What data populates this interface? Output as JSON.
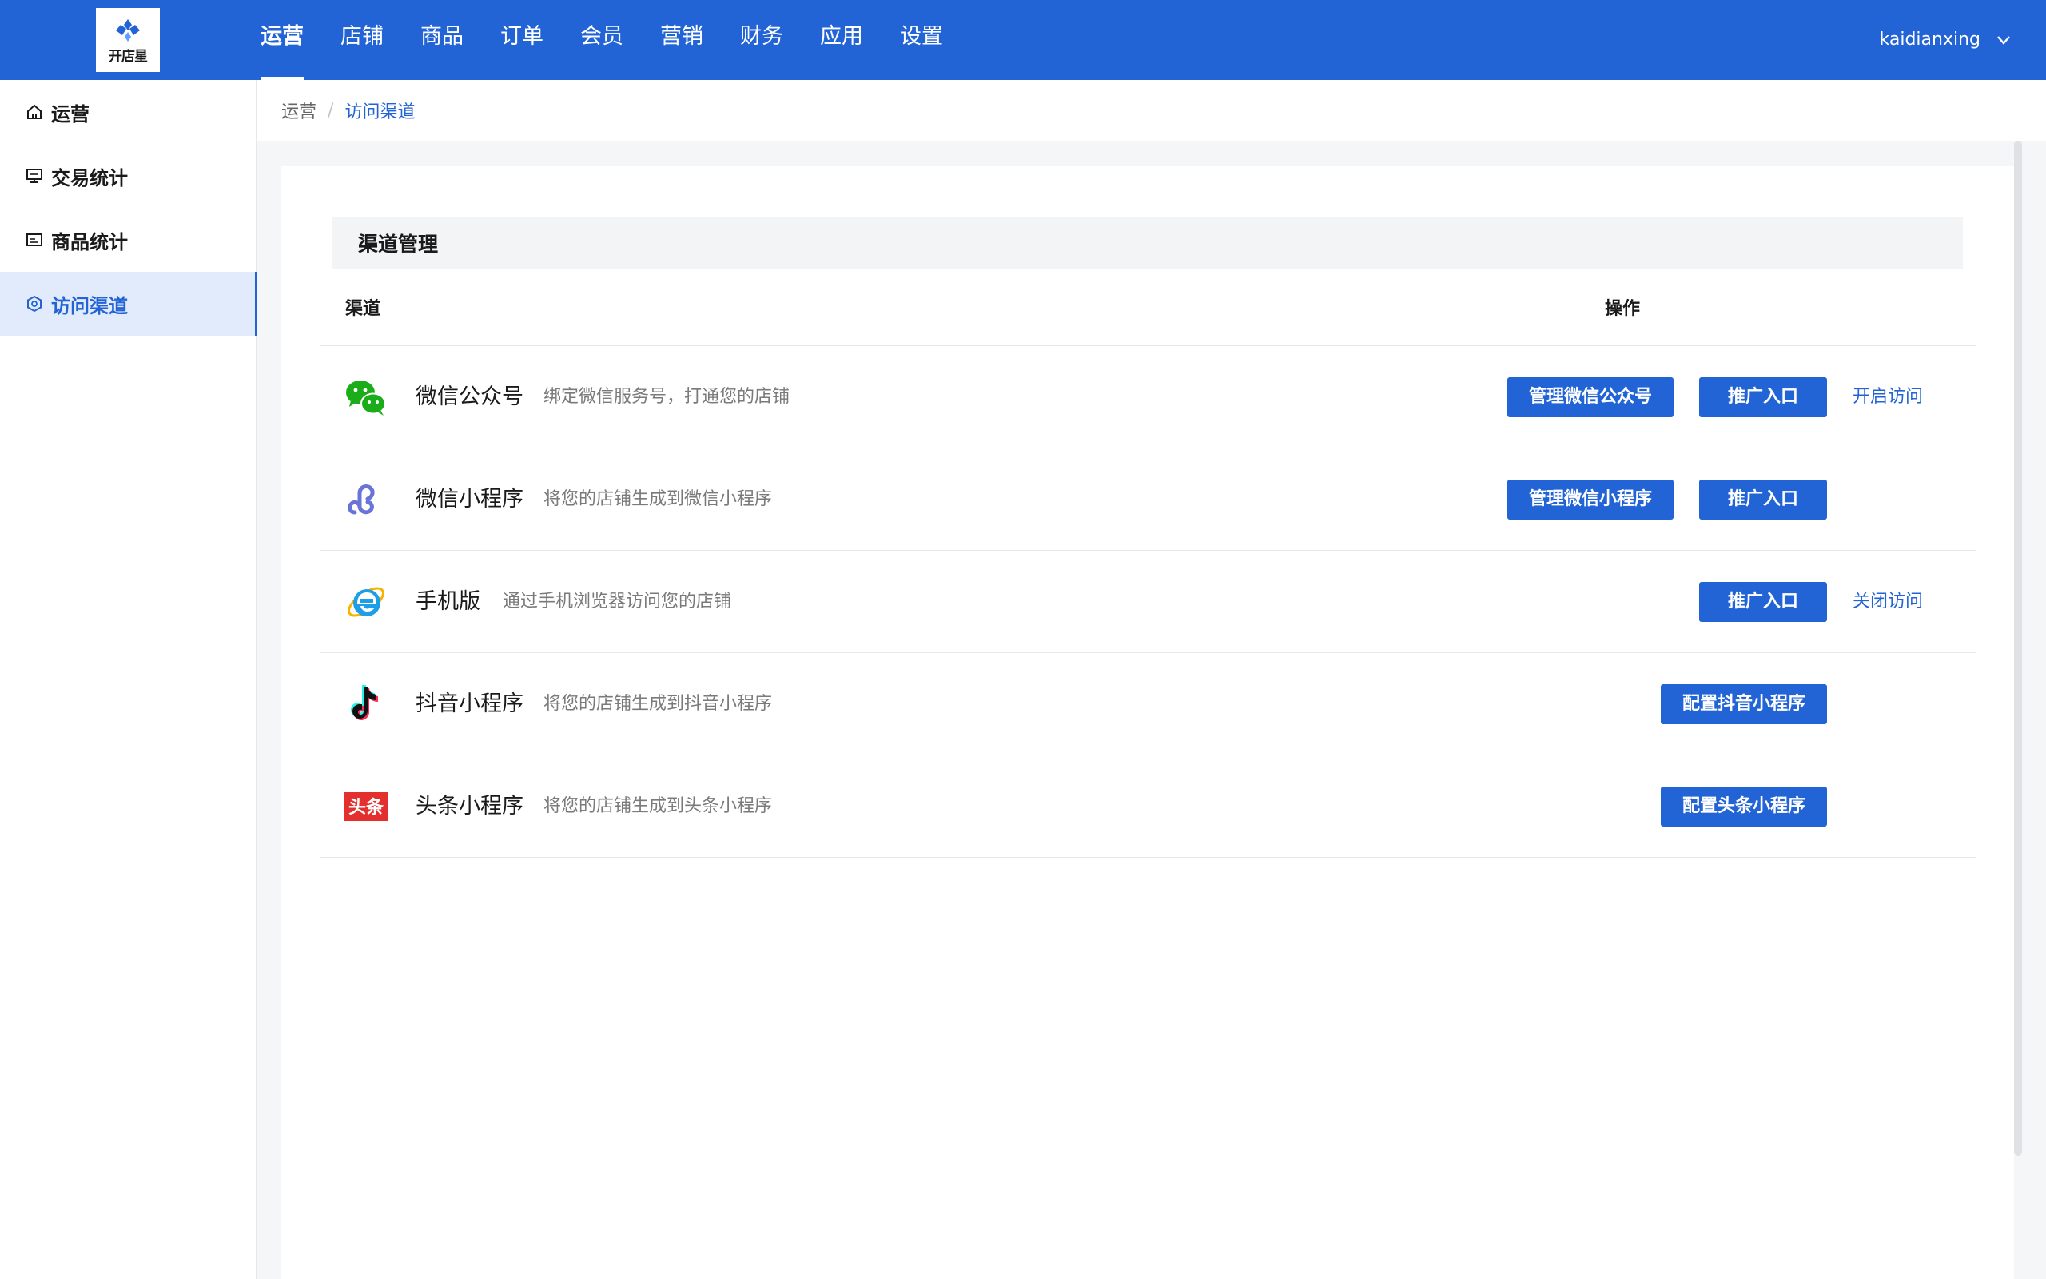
{
  "app": {
    "logo_text": "开店星",
    "user_name": "kaidianxing"
  },
  "colors": {
    "primary": "#2264d6",
    "wechat_green": "#1aad19",
    "miniprogram_purple": "#6a74d8",
    "ie_blue": "#1e9ee6",
    "toutiao_red": "#e3302f"
  },
  "nav": {
    "items": [
      {
        "label": "运营",
        "active": true
      },
      {
        "label": "店铺"
      },
      {
        "label": "商品"
      },
      {
        "label": "订单"
      },
      {
        "label": "会员"
      },
      {
        "label": "营销"
      },
      {
        "label": "财务"
      },
      {
        "label": "应用"
      },
      {
        "label": "设置"
      }
    ]
  },
  "sidebar": {
    "items": [
      {
        "label": "运营",
        "icon": "home-icon"
      },
      {
        "label": "交易统计",
        "icon": "monitor-icon"
      },
      {
        "label": "商品统计",
        "icon": "chart-icon"
      },
      {
        "label": "访问渠道",
        "icon": "channel-icon",
        "active": true
      }
    ]
  },
  "breadcrumb": {
    "parent": "运营",
    "separator": "/",
    "current": "访问渠道"
  },
  "section": {
    "title": "渠道管理",
    "col_channel": "渠道",
    "col_action": "操作"
  },
  "channels": [
    {
      "name": "微信公众号",
      "desc": "绑定微信服务号，打通您的店铺",
      "icon": "wechat-icon",
      "buttons": [
        "管理微信公众号",
        "推广入口"
      ],
      "link": "开启访问"
    },
    {
      "name": "微信小程序",
      "desc": "将您的店铺生成到微信小程序",
      "icon": "miniprogram-icon",
      "buttons": [
        "管理微信小程序",
        "推广入口"
      ]
    },
    {
      "name": "手机版",
      "desc": "通过手机浏览器访问您的店铺",
      "icon": "mobile-browser-icon",
      "buttons": [
        "推广入口"
      ],
      "link": "关闭访问"
    },
    {
      "name": "抖音小程序",
      "desc": "将您的店铺生成到抖音小程序",
      "icon": "douyin-icon",
      "buttons": [
        "配置抖音小程序"
      ]
    },
    {
      "name": "头条小程序",
      "desc": "将您的店铺生成到头条小程序",
      "icon": "toutiao-icon",
      "icon_text": "头条",
      "buttons": [
        "配置头条小程序"
      ]
    }
  ]
}
